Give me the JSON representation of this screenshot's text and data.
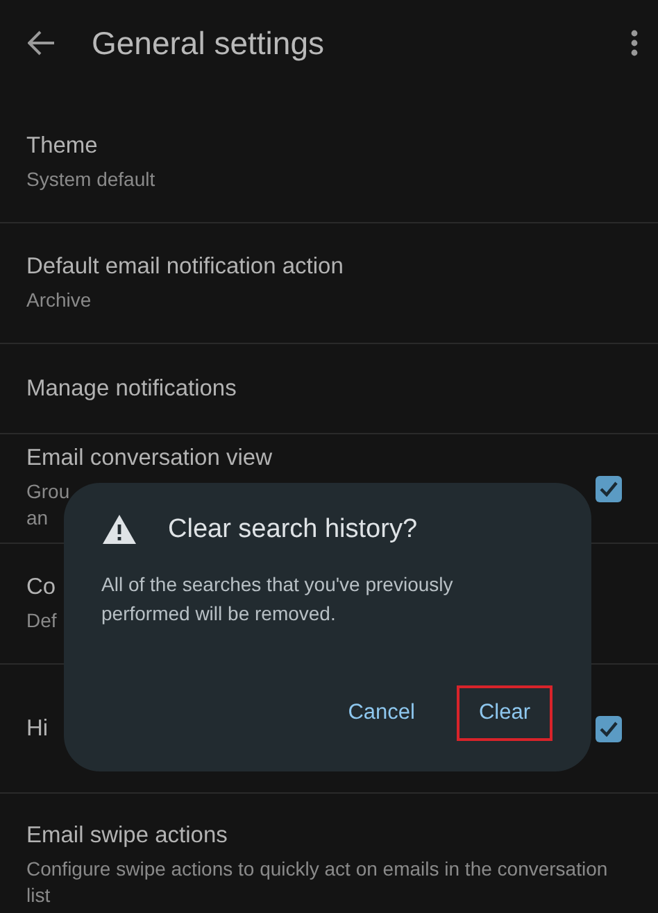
{
  "app_bar": {
    "title": "General settings"
  },
  "settings": [
    {
      "kind": "text",
      "title": "Theme",
      "subtitle": [
        "System default"
      ]
    },
    {
      "kind": "text",
      "title": "Default email notification action",
      "subtitle": [
        "Archive"
      ]
    },
    {
      "kind": "text",
      "title": "Manage notifications"
    },
    {
      "kind": "checkbox",
      "title": "Email conversation view",
      "subtitle": [
        "Grou",
        "an"
      ],
      "checked": true
    },
    {
      "kind": "text",
      "title": "Co",
      "subtitle": [
        "Def"
      ]
    },
    {
      "kind": "checkbox",
      "title": "Hi",
      "checked": true
    },
    {
      "kind": "text",
      "title": "Email swipe actions",
      "subtitle": [
        "Configure swipe actions to quickly act on emails in the conversation list"
      ]
    }
  ],
  "dialog": {
    "title": "Clear search history?",
    "message": "All of the searches that you've previously performed will be removed.",
    "actions": [
      {
        "label": "Cancel",
        "highlighted": false
      },
      {
        "label": "Clear",
        "highlighted": true
      }
    ]
  }
}
